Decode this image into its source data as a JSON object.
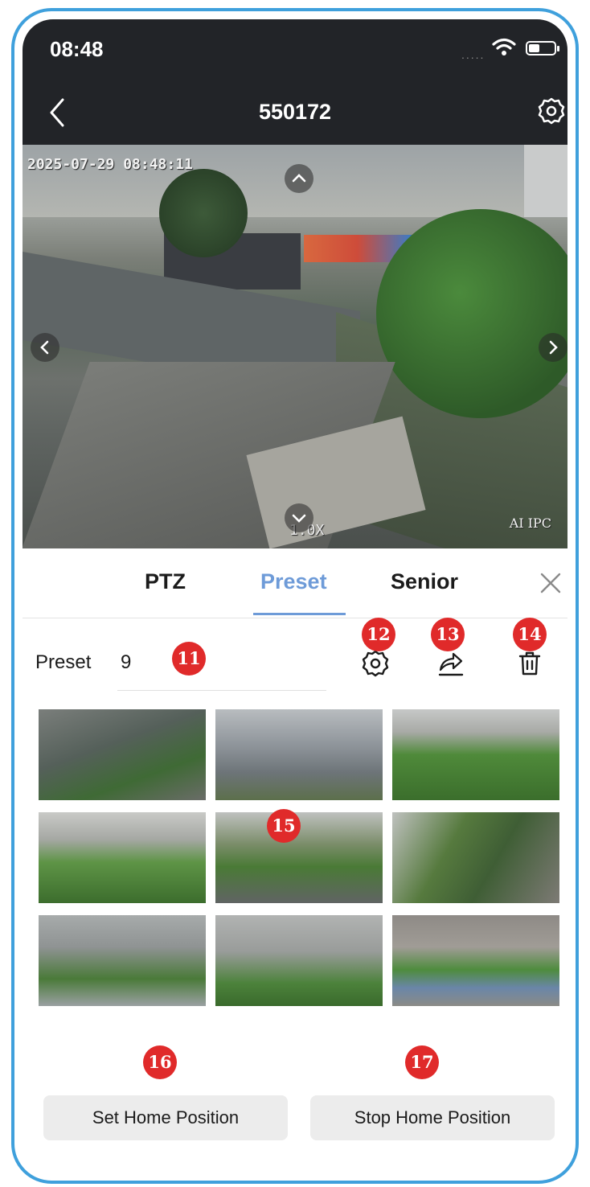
{
  "status_bar": {
    "time": "08:48",
    "signal": "....."
  },
  "nav": {
    "title": "550172"
  },
  "video": {
    "timestamp": "2025-07-29 08:48:11",
    "zoom": "1.0X",
    "watermark": "AI IPC"
  },
  "tabs": [
    {
      "label": "PTZ",
      "active": false
    },
    {
      "label": "Preset",
      "active": true
    },
    {
      "label": "Senior",
      "active": false
    }
  ],
  "preset": {
    "label": "Preset",
    "value": "9"
  },
  "annotations": {
    "preset_value": "11",
    "settings": "12",
    "share": "13",
    "delete": "14",
    "thumbnails": "15",
    "set_home": "16",
    "stop_home": "17"
  },
  "buttons": {
    "set_home": "Set Home Position",
    "stop_home": "Stop Home Position"
  },
  "colors": {
    "accent": "#6e9bd8",
    "badge": "#e02a2a",
    "frame": "#3fa0dc",
    "topbar": "#222428"
  }
}
